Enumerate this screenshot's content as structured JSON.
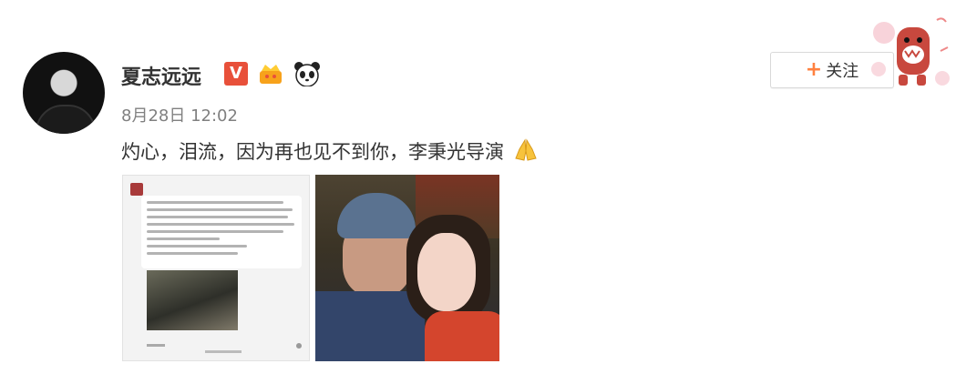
{
  "user": {
    "name": "夏志远远",
    "verified_label": "V",
    "badges": [
      "vip-verified-icon",
      "crown-badge-icon",
      "panda-badge-icon"
    ]
  },
  "post": {
    "timestamp": "8月28日 12:02",
    "text": "灼心，泪流，因为再也见不到你，李秉光导演",
    "text_emoji": "pray-icon"
  },
  "follow_button": {
    "label": "关注",
    "plus": "+"
  },
  "colors": {
    "accent": "#ff8140",
    "verified": "#e8503a",
    "timestamp": "#808080"
  }
}
